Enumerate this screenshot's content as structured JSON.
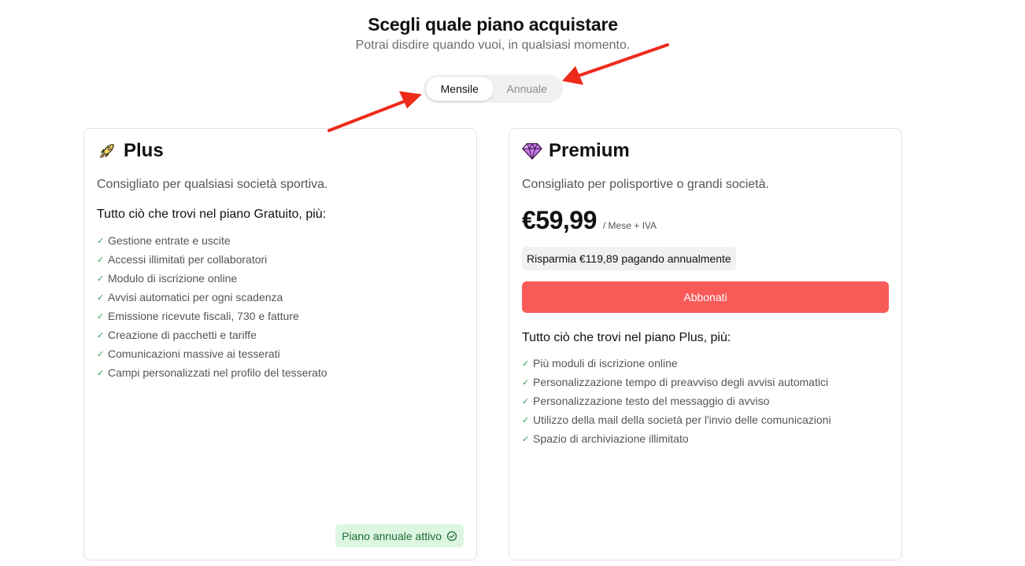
{
  "header": {
    "title": "Scegli quale piano acquistare",
    "subtitle": "Potrai disdire quando vuoi, in qualsiasi momento."
  },
  "billing_toggle": {
    "options": [
      "Mensile",
      "Annuale"
    ],
    "selected": "Mensile"
  },
  "plans": [
    {
      "name": "Plus",
      "icon": "rocket-icon",
      "description": "Consigliato per qualsiasi società sportiva.",
      "features_title": "Tutto ciò che trovi nel piano Gratuito, più:",
      "features": [
        "Gestione entrate e uscite",
        "Accessi illimitati per collaboratori",
        "Modulo di iscrizione online",
        "Avvisi automatici per ogni scadenza",
        "Emissione ricevute fiscali, 730 e fatture",
        "Creazione di pacchetti e tariffe",
        "Comunicazioni massive ai tesserati",
        "Campi personalizzati nel profilo del tesserato"
      ],
      "badge": "Piano annuale attivo",
      "badge_icon": "check-circle-icon"
    },
    {
      "name": "Premium",
      "icon": "diamond-icon",
      "description": "Consigliato per polisportive o grandi società.",
      "price": "€59,99",
      "price_unit": "/ Mese + IVA",
      "savings": "Risparmia €119,89 pagando annualmente",
      "cta_label": "Abbonati",
      "features_title": "Tutto ciò che trovi nel piano Plus, più:",
      "features": [
        "Più moduli di iscrizione online",
        "Personalizzazione tempo di preavviso degli avvisi automatici",
        "Personalizzazione testo del messaggio di avviso",
        "Utilizzo della mail della società per l'invio delle comunicazioni",
        "Spazio di archiviazione illimitato"
      ]
    }
  ],
  "colors": {
    "cta": "#f85a58",
    "badge_bg": "#dcf6e2",
    "badge_text": "#1e6b33",
    "annotation_arrow": "#ee2a1b",
    "check": "#2f9e55"
  }
}
